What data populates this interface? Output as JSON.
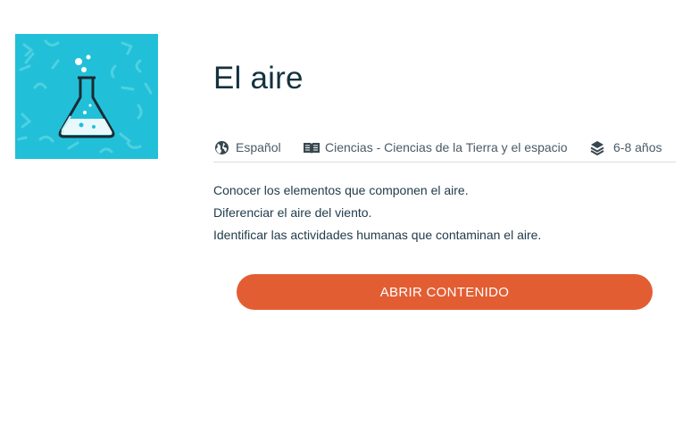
{
  "resource": {
    "title": "El aire",
    "thumbnail_icon": "flask-icon",
    "thumbnail_color": "#21c0d8"
  },
  "meta": {
    "language": {
      "icon": "globe-icon",
      "label": "Español"
    },
    "subject": {
      "icon": "book-icon",
      "label": "Ciencias - Ciencias de la Tierra y el espacio"
    },
    "age": {
      "icon": "layers-icon",
      "label": "6-8 años"
    }
  },
  "objectives": [
    "Conocer los elementos que componen el aire.",
    "Diferenciar el aire del viento.",
    "Identificar las actividades humanas que contaminan el aire."
  ],
  "actions": {
    "open_label": "ABRIR CONTENIDO",
    "accent_color": "#e35d33"
  }
}
